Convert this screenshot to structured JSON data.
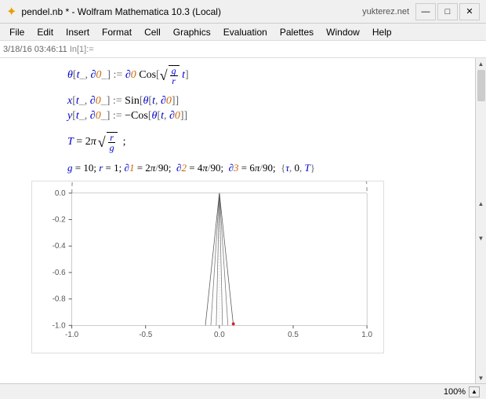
{
  "titlebar": {
    "icon": "★",
    "title": "pendel.nb * - Wolfram Mathematica 10.3 (Local)",
    "server_label": "yukterez.net",
    "minimize_label": "—",
    "maximize_label": "□",
    "close_label": "✕"
  },
  "menubar": {
    "items": [
      "File",
      "Edit",
      "Insert",
      "Format",
      "Cell",
      "Graphics",
      "Evaluation",
      "Palettes",
      "Window",
      "Help"
    ]
  },
  "toolbar": {
    "timestamp": "3/18/16 03:46:11",
    "cell_label": "In[1]:="
  },
  "statusbar": {
    "zoom": "100%"
  },
  "math": {
    "line1": "θ[t_, ∂0_] := ∂0 Cos[√(g/r) t]",
    "line2": "x[t_, ∂0_] := Sin[θ[t, ∂0]]",
    "line3": "y[t_, ∂0_] := -Cos[θ[t, ∂0]]",
    "line4": "T = 2π √(r/g) ;",
    "line5": "g = 10; r = 1; ∂1 = 2π/90;  ∂2 = 4π/90;  ∂3 = 6π/90;  {τ, 0, T}"
  },
  "graph": {
    "x_axis_labels": [
      "-1.0",
      "-0.5",
      "0.0",
      "0.5",
      "1.0"
    ],
    "y_axis_labels": [
      "0.0",
      "-0.2",
      "-0.4",
      "-0.6",
      "-0.8",
      "-1.0"
    ]
  }
}
